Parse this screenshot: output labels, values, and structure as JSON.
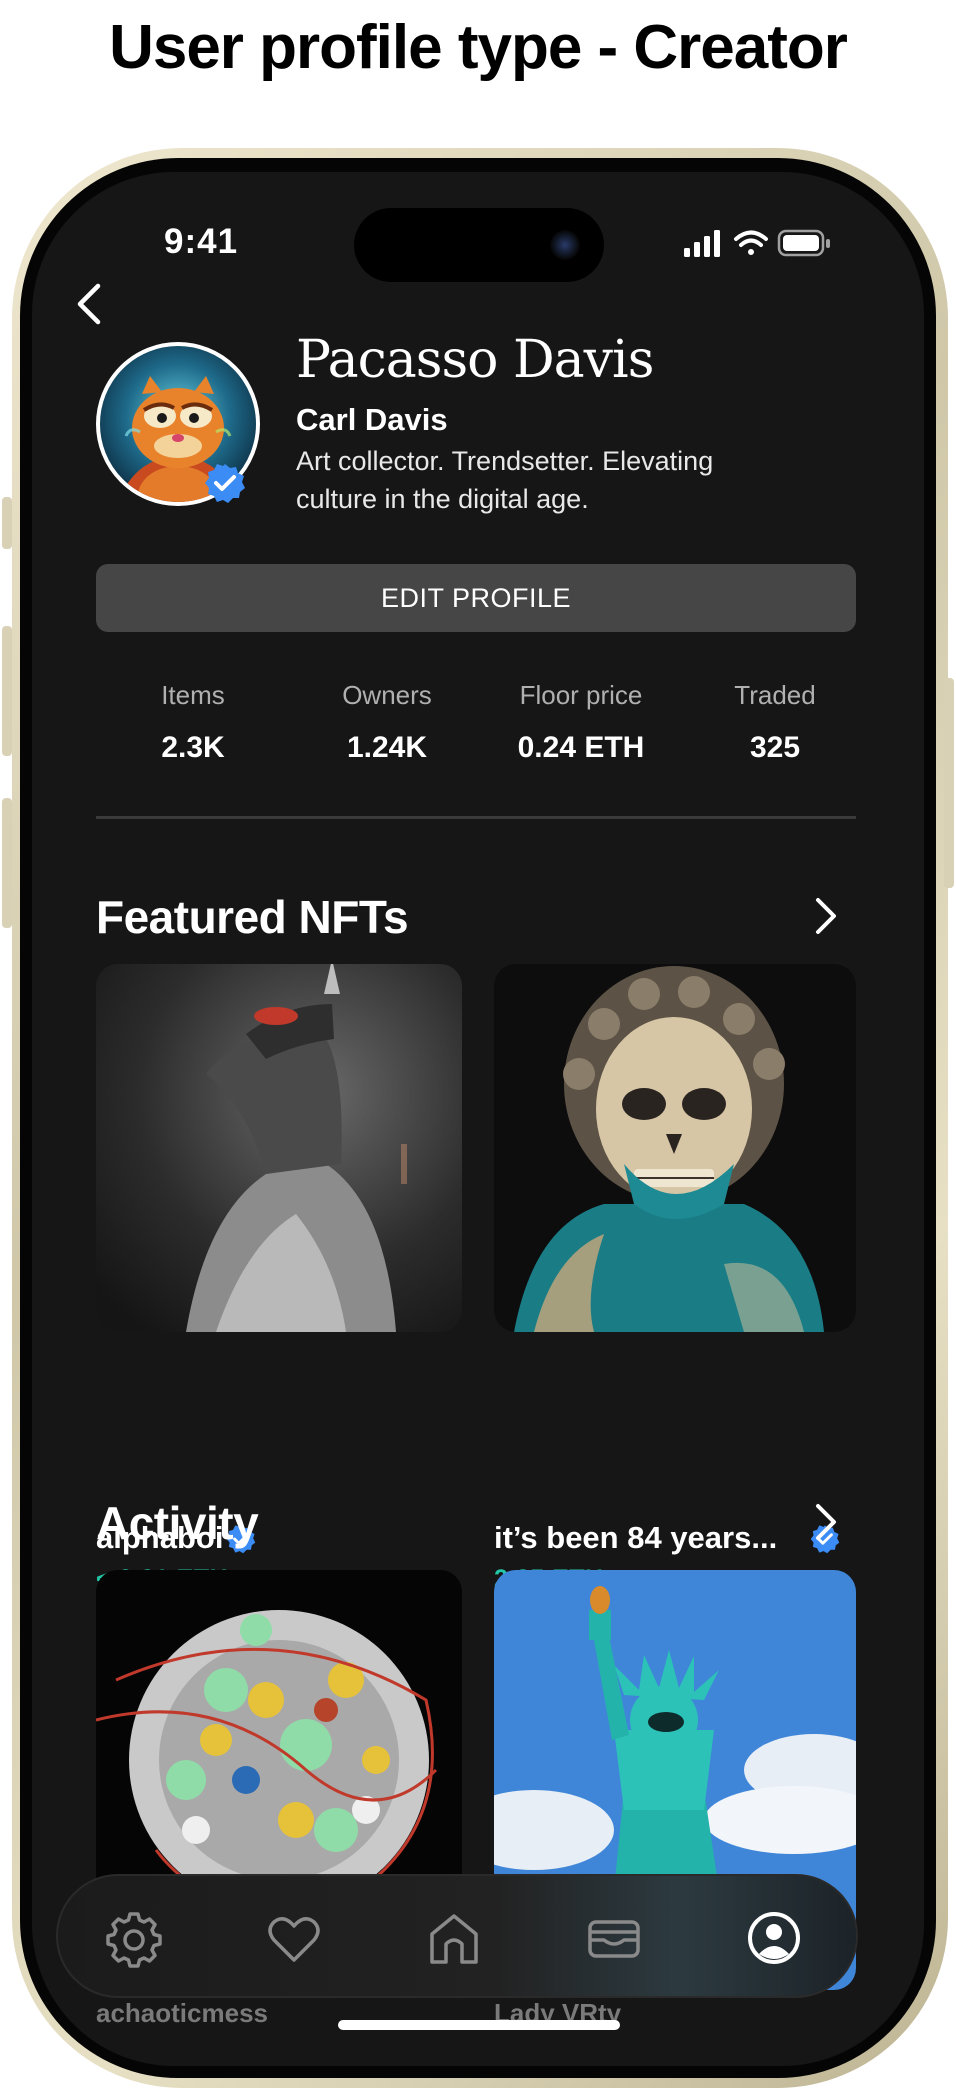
{
  "heading": "User profile type - Creator",
  "status_bar": {
    "time": "9:41"
  },
  "profile": {
    "display_name": "Pacasso Davis",
    "username": "Carl Davis",
    "bio": "Art collector. Trendsetter. Elevating culture in the digital age.",
    "edit_button": "EDIT PROFILE"
  },
  "stats": [
    {
      "label": "Items",
      "value": "2.3K"
    },
    {
      "label": "Owners",
      "value": "1.24K"
    },
    {
      "label": "Floor price",
      "value": "0.24 ETH"
    },
    {
      "label": "Traded",
      "value": "325"
    }
  ],
  "featured": {
    "title": "Featured NFTs",
    "items": [
      {
        "name": "alphaboi",
        "price": "< 0.01 ETH"
      },
      {
        "name": "it’s been 84 years...",
        "price": "2.35 ETH"
      }
    ]
  },
  "activity": {
    "title": "Activity",
    "items": [
      {
        "name": "achaoticmess"
      },
      {
        "name": "Lady VRty"
      }
    ]
  },
  "tabs": [
    {
      "icon": "gear-icon"
    },
    {
      "icon": "heart-icon"
    },
    {
      "icon": "home-icon"
    },
    {
      "icon": "wallet-icon"
    },
    {
      "icon": "profile-icon"
    }
  ],
  "colors": {
    "accent_price": "#22c7a7",
    "verified": "#3b8cf5",
    "screen_bg": "#161616"
  }
}
